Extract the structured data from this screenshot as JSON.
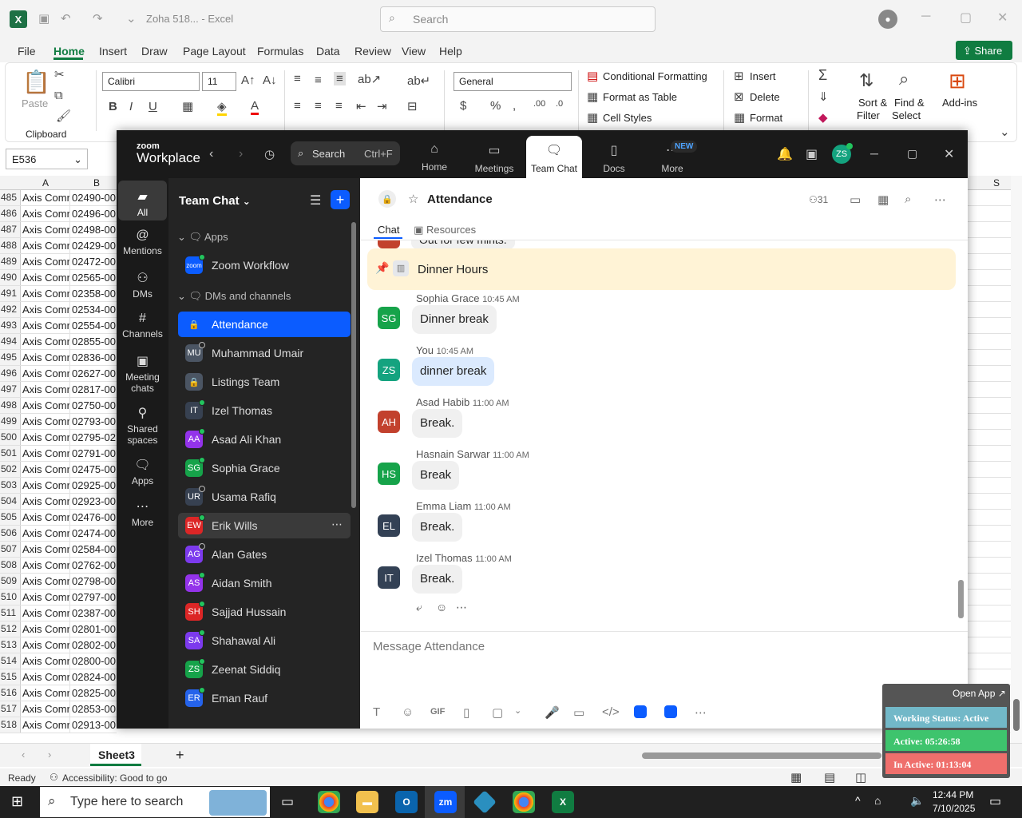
{
  "excel": {
    "doc_title": "Zoha 518... - Excel",
    "search_placeholder": "Search",
    "menu": [
      "File",
      "Home",
      "Insert",
      "Draw",
      "Page Layout",
      "Formulas",
      "Data",
      "Review",
      "View",
      "Help"
    ],
    "share_label": "Share",
    "ribbon": {
      "paste": "Paste",
      "clipboard": "Clipboard",
      "font_name": "Calibri",
      "font_size": "11",
      "number_format": "General",
      "conditional_formatting": "Conditional Formatting",
      "format_as_table": "Format as Table",
      "cell_styles": "Cell Styles",
      "insert": "Insert",
      "delete": "Delete",
      "format": "Format",
      "sort_filter_1": "Sort &",
      "sort_filter_2": "Filter",
      "find_select_1": "Find &",
      "find_select_2": "Select",
      "add_ins": "Add-ins"
    },
    "name_box": "E536",
    "col_a": "A",
    "col_b": "B",
    "col_s": "S",
    "rows": [
      {
        "n": "485",
        "a": "Axis Comr",
        "b": "02490-00"
      },
      {
        "n": "486",
        "a": "Axis Comr",
        "b": "02496-00"
      },
      {
        "n": "487",
        "a": "Axis Comr",
        "b": "02498-00"
      },
      {
        "n": "488",
        "a": "Axis Comr",
        "b": "02429-00"
      },
      {
        "n": "489",
        "a": "Axis Comr",
        "b": "02472-00"
      },
      {
        "n": "490",
        "a": "Axis Comr",
        "b": "02565-00"
      },
      {
        "n": "491",
        "a": "Axis Comr",
        "b": "02358-00"
      },
      {
        "n": "492",
        "a": "Axis Comr",
        "b": "02534-00"
      },
      {
        "n": "493",
        "a": "Axis Comr",
        "b": "02554-00"
      },
      {
        "n": "494",
        "a": "Axis Comr",
        "b": "02855-00"
      },
      {
        "n": "495",
        "a": "Axis Comr",
        "b": "02836-00"
      },
      {
        "n": "496",
        "a": "Axis Comr",
        "b": "02627-00"
      },
      {
        "n": "497",
        "a": "Axis Comr",
        "b": "02817-00"
      },
      {
        "n": "498",
        "a": "Axis Comr",
        "b": "02750-00"
      },
      {
        "n": "499",
        "a": "Axis Comr",
        "b": "02793-00"
      },
      {
        "n": "500",
        "a": "Axis Comr",
        "b": "02795-02"
      },
      {
        "n": "501",
        "a": "Axis Comr",
        "b": "02791-00"
      },
      {
        "n": "502",
        "a": "Axis Comr",
        "b": "02475-00"
      },
      {
        "n": "503",
        "a": "Axis Comr",
        "b": "02925-00"
      },
      {
        "n": "504",
        "a": "Axis Comr",
        "b": "02923-00"
      },
      {
        "n": "505",
        "a": "Axis Comr",
        "b": "02476-00"
      },
      {
        "n": "506",
        "a": "Axis Comr",
        "b": "02474-00"
      },
      {
        "n": "507",
        "a": "Axis Comr",
        "b": "02584-00"
      },
      {
        "n": "508",
        "a": "Axis Comr",
        "b": "02762-00"
      },
      {
        "n": "509",
        "a": "Axis Comr",
        "b": "02798-00"
      },
      {
        "n": "510",
        "a": "Axis Comr",
        "b": "02797-00"
      },
      {
        "n": "511",
        "a": "Axis Comr",
        "b": "02387-00"
      },
      {
        "n": "512",
        "a": "Axis Comr",
        "b": "02801-00"
      },
      {
        "n": "513",
        "a": "Axis Comr",
        "b": "02802-00"
      },
      {
        "n": "514",
        "a": "Axis Comr",
        "b": "02800-00"
      },
      {
        "n": "515",
        "a": "Axis Comr",
        "b": "02824-00"
      },
      {
        "n": "516",
        "a": "Axis Comr",
        "b": "02825-00"
      },
      {
        "n": "517",
        "a": "Axis Comr",
        "b": "02853-00"
      },
      {
        "n": "518",
        "a": "Axis Comr",
        "b": "02913-00"
      }
    ],
    "sheet_tab": "Sheet3",
    "status_ready": "Ready",
    "status_accessibility": "Accessibility: Good to go"
  },
  "zoom": {
    "brand_small": "zoom",
    "brand": "Workplace",
    "search_label": "Search",
    "search_shortcut": "Ctrl+F",
    "top_tabs": [
      {
        "label": "Home",
        "icon": "home-icon"
      },
      {
        "label": "Meetings",
        "icon": "video-icon"
      },
      {
        "label": "Team Chat",
        "icon": "chat-icon"
      },
      {
        "label": "Docs",
        "icon": "doc-icon"
      },
      {
        "label": "More",
        "icon": "more-icon"
      }
    ],
    "new_badge": "NEW",
    "user_initials": "ZS",
    "left_nav": [
      {
        "label": "All"
      },
      {
        "label": "Mentions"
      },
      {
        "label": "DMs"
      },
      {
        "label": "Channels"
      },
      {
        "label": "Meeting chats"
      },
      {
        "label": "Shared spaces"
      },
      {
        "label": "Apps"
      },
      {
        "label": "More"
      }
    ],
    "list_title": "Team Chat",
    "section_apps": "Apps",
    "section_dms": "DMs and channels",
    "zoom_workflow": "Zoom Workflow",
    "contacts": [
      {
        "initials": "",
        "name": "Attendance",
        "color": "#0b5cff"
      },
      {
        "initials": "MU",
        "name": "Muhammad Umair",
        "color": "#4b5563"
      },
      {
        "initials": "",
        "name": "Listings Team",
        "color": "#4b5563"
      },
      {
        "initials": "IT",
        "name": "Izel Thomas",
        "color": "#374151"
      },
      {
        "initials": "AA",
        "name": "Asad Ali Khan",
        "color": "#9333ea"
      },
      {
        "initials": "SG",
        "name": "Sophia Grace",
        "color": "#16a34a"
      },
      {
        "initials": "UR",
        "name": "Usama Rafiq",
        "color": "#374151"
      },
      {
        "initials": "EW",
        "name": "Erik Wills",
        "color": "#dc2626"
      },
      {
        "initials": "AG",
        "name": "Alan Gates",
        "color": "#7c3aed"
      },
      {
        "initials": "AS",
        "name": "Aidan Smith",
        "color": "#9333ea"
      },
      {
        "initials": "SH",
        "name": "Sajjad Hussain",
        "color": "#dc2626"
      },
      {
        "initials": "SA",
        "name": "Shahawal Ali",
        "color": "#7c3aed"
      },
      {
        "initials": "ZS",
        "name": "Zeenat Siddiq",
        "color": "#16a34a"
      },
      {
        "initials": "ER",
        "name": "Eman Rauf",
        "color": "#2563eb"
      }
    ],
    "chat": {
      "channel": "Attendance",
      "member_count": "31",
      "tab_chat": "Chat",
      "tab_resources": "Resources",
      "partial_msg": "Out for few mints.",
      "pinned": "Dinner Hours",
      "messages": [
        {
          "initials": "SG",
          "name": "Sophia Grace",
          "time": "10:45 AM",
          "text": "Dinner break",
          "color": "#16a34a"
        },
        {
          "initials": "ZS",
          "name": "You",
          "time": "10:45 AM",
          "text": "dinner break",
          "color": "#14a37f"
        },
        {
          "initials": "AH",
          "name": "Asad Habib",
          "time": "11:00 AM",
          "text": "Break.",
          "color": "#c2412d"
        },
        {
          "initials": "HS",
          "name": "Hasnain Sarwar",
          "time": "11:00 AM",
          "text": "Break",
          "color": "#16a34a"
        },
        {
          "initials": "EL",
          "name": "Emma Liam",
          "time": "11:00 AM",
          "text": "Break.",
          "color": "#334155"
        },
        {
          "initials": "IT",
          "name": "Izel Thomas",
          "time": "11:00 AM",
          "text": "Break.",
          "color": "#334155"
        }
      ],
      "compose_placeholder": "Message Attendance",
      "gif": "GIF"
    }
  },
  "status_widget": {
    "open_app": "Open App",
    "working": "Working Status: Active",
    "active": "Active: 05:26:58",
    "inactive": "In Active: 01:13:04"
  },
  "taskbar": {
    "search_placeholder": "Type here to search",
    "time": "12:44 PM",
    "date": "7/10/2025"
  }
}
